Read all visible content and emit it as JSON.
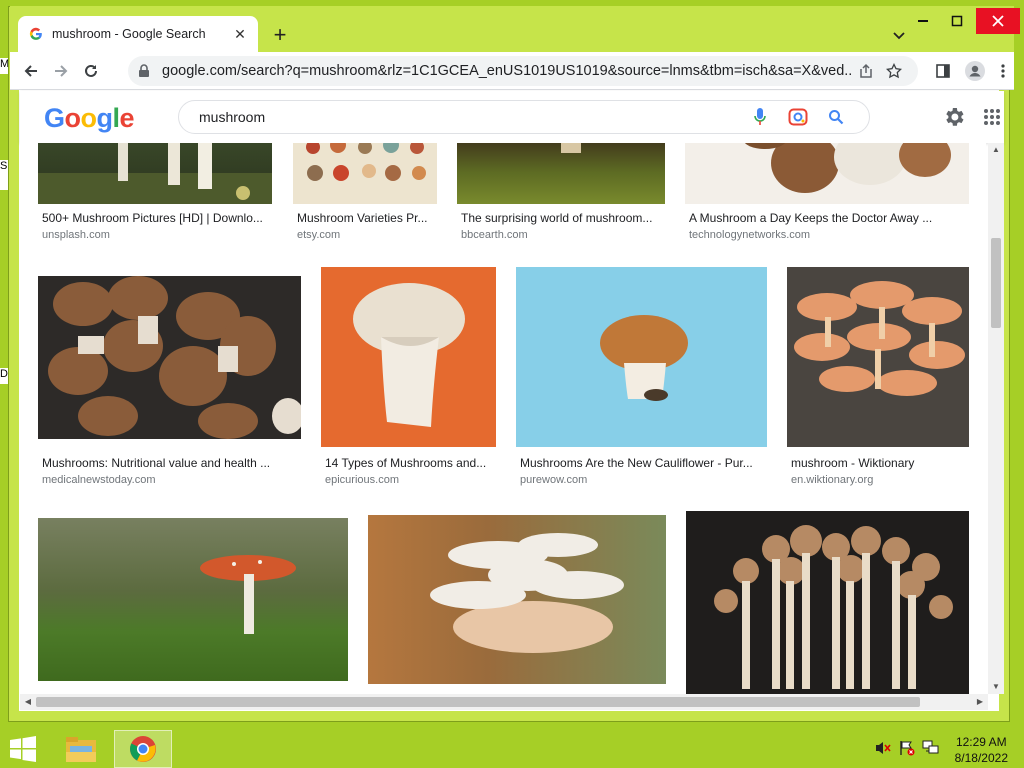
{
  "browser": {
    "tab_title": "mushroom - Google Search",
    "url": "google.com/search?q=mushroom&rlz=1C1GCEA_enUS1019US1019&source=lnms&tbm=isch&sa=X&ved...",
    "favicon": "google-g-icon"
  },
  "google": {
    "search_query": "mushroom"
  },
  "results": [
    {
      "caption": "500+ Mushroom Pictures [HD] | Downlo...",
      "source": "unsplash.com"
    },
    {
      "caption": "Mushroom Varieties Pr...",
      "source": "etsy.com"
    },
    {
      "caption": "The surprising world of mushroom...",
      "source": "bbcearth.com"
    },
    {
      "caption": "A Mushroom a Day Keeps the Doctor Away ...",
      "source": "technologynetworks.com"
    },
    {
      "caption": "Mushrooms: Nutritional value and health ...",
      "source": "medicalnewstoday.com"
    },
    {
      "caption": "14 Types of Mushrooms and...",
      "source": "epicurious.com"
    },
    {
      "caption": "Mushrooms Are the New Cauliflower - Pur...",
      "source": "purewow.com"
    },
    {
      "caption": "mushroom - Wiktionary",
      "source": "en.wiktionary.org"
    },
    {
      "caption": "",
      "source": ""
    },
    {
      "caption": "",
      "source": ""
    },
    {
      "caption": "",
      "source": ""
    }
  ],
  "taskbar": {
    "time": "12:29 AM",
    "date": "8/18/2022"
  },
  "desktop_fragments": [
    "M",
    "S",
    "D"
  ],
  "colors": {
    "desktop": "#a6cf26",
    "window_frame": "#c6e44a",
    "close_red": "#e81123",
    "google_blue": "#4285f4",
    "google_red": "#ea4335",
    "google_yellow": "#fbbc05",
    "google_green": "#34a853"
  }
}
